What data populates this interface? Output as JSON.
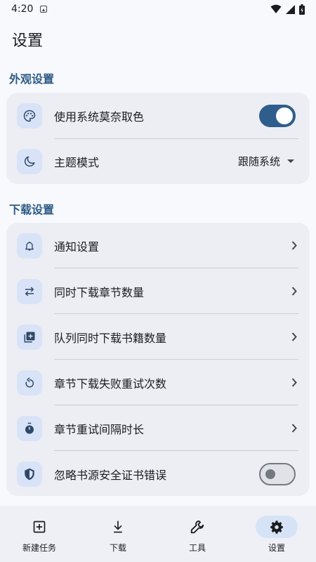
{
  "status_bar": {
    "time": "4:20"
  },
  "header": {
    "title": "设置"
  },
  "appearance": {
    "section_title": "外观设置",
    "monet_label": "使用系统莫奈取色",
    "monet_enabled": true,
    "theme_label": "主题模式",
    "theme_value": "跟随系统"
  },
  "download": {
    "section_title": "下载设置",
    "items": [
      {
        "label": "通知设置",
        "icon": "bell-icon"
      },
      {
        "label": "同时下载章节数量",
        "icon": "swap-arrows-icon"
      },
      {
        "label": "队列同时下载书籍数量",
        "icon": "add-library-icon"
      },
      {
        "label": "章节下载失败重试次数",
        "icon": "retry-icon"
      },
      {
        "label": "章节重试间隔时长",
        "icon": "timer-icon"
      }
    ],
    "ignore_cert_label": "忽略书源安全证书错误",
    "ignore_cert_enabled": false
  },
  "bottom_nav": {
    "items": [
      {
        "label": "新建任务",
        "icon": "add-box-icon"
      },
      {
        "label": "下载",
        "icon": "download-icon"
      },
      {
        "label": "工具",
        "icon": "wrench-icon"
      },
      {
        "label": "设置",
        "icon": "gear-icon",
        "active": true
      }
    ]
  },
  "colors": {
    "accent": "#2f5d8c",
    "section_title": "#2c5a84",
    "card_bg": "#eceef4",
    "icon_bg": "#d9e3f7",
    "active_nav_bg": "#d6e3f7"
  }
}
